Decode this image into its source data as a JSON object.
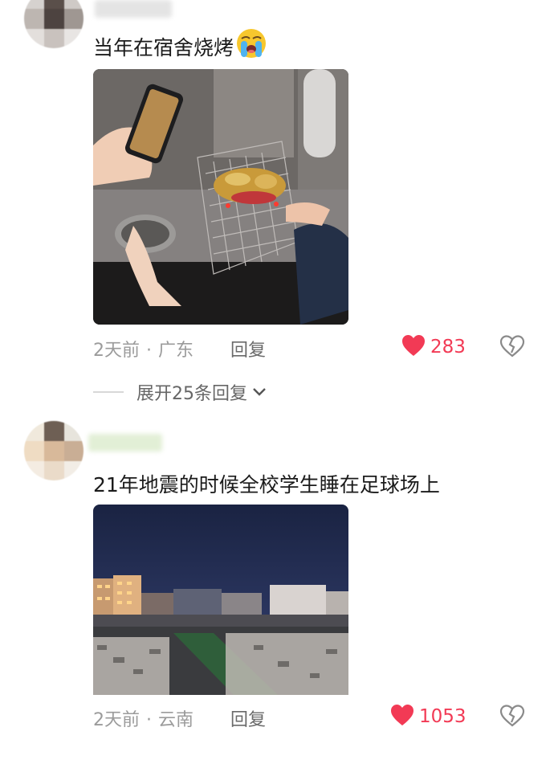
{
  "comments": [
    {
      "text": "当年在宿舍烧烤",
      "emoji": "crying-face",
      "meta_time": "2天前",
      "meta_region": "广东",
      "reply_label": "回复",
      "likes": "283",
      "expand_label": "展开25条回复"
    },
    {
      "text": "21年地震的时候全校学生睡在足球场上",
      "meta_time": "2天前",
      "meta_region": "云南",
      "reply_label": "回复",
      "likes": "1053"
    }
  ],
  "colors": {
    "like": "#f23a55",
    "meta": "#9b9b9b"
  },
  "icons": [
    "heart-icon",
    "broken-heart-icon",
    "chevron-down-icon"
  ]
}
